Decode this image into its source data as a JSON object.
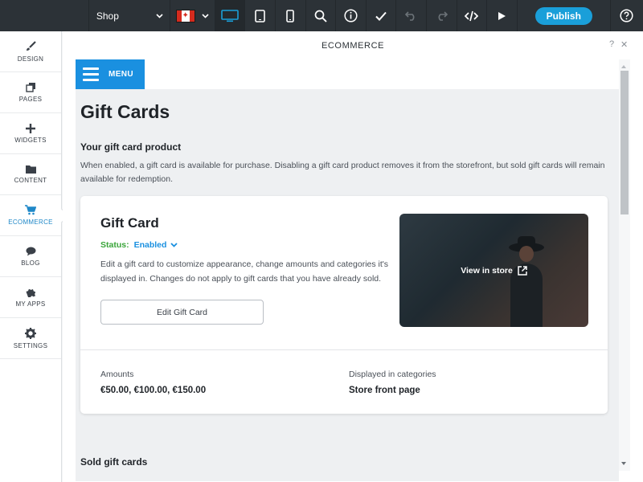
{
  "toolbar": {
    "page_select": "Shop",
    "language_flag": "canada-flag",
    "publish_label": "Publish",
    "icons": [
      "desktop-icon",
      "tablet-icon",
      "mobile-icon",
      "search-icon",
      "info-icon",
      "check-icon",
      "undo-icon",
      "redo-icon",
      "code-icon",
      "play-icon",
      "help-icon"
    ],
    "accent_color": "#1a9fd9"
  },
  "sidebar": {
    "items": [
      {
        "label": "DESIGN",
        "icon": "brush-icon"
      },
      {
        "label": "PAGES",
        "icon": "pages-icon"
      },
      {
        "label": "WIDGETS",
        "icon": "plus-icon"
      },
      {
        "label": "CONTENT",
        "icon": "folder-icon"
      },
      {
        "label": "ECOMMERCE",
        "icon": "cart-icon",
        "active": true
      },
      {
        "label": "BLOG",
        "icon": "chat-bubble-icon"
      },
      {
        "label": "MY APPS",
        "icon": "puzzle-icon"
      },
      {
        "label": "SETTINGS",
        "icon": "gear-icon"
      }
    ],
    "active_color": "#1f88c8"
  },
  "panel": {
    "title": "ECOMMERCE",
    "help": "?",
    "close": "✕"
  },
  "content": {
    "menu_label": "MENU",
    "page_title": "Gift Cards",
    "section_title": "Your gift card product",
    "section_desc": "When enabled, a gift card is available for purchase. Disabling a gift card product removes it from the storefront, but sold gift cards will remain available for redemption.",
    "card": {
      "title": "Gift Card",
      "status_label": "Status:",
      "status_value": "Enabled",
      "description": "Edit a gift card to customize appearance, change amounts and categories it's displayed in. Changes do not apply to gift cards that you have already sold.",
      "edit_button": "Edit Gift Card",
      "image_link": "View in store",
      "amounts_label": "Amounts",
      "amounts_value": "€50.00, €100.00, €150.00",
      "categories_label": "Displayed in categories",
      "categories_value": "Store front page"
    },
    "sold_title": "Sold gift cards"
  }
}
